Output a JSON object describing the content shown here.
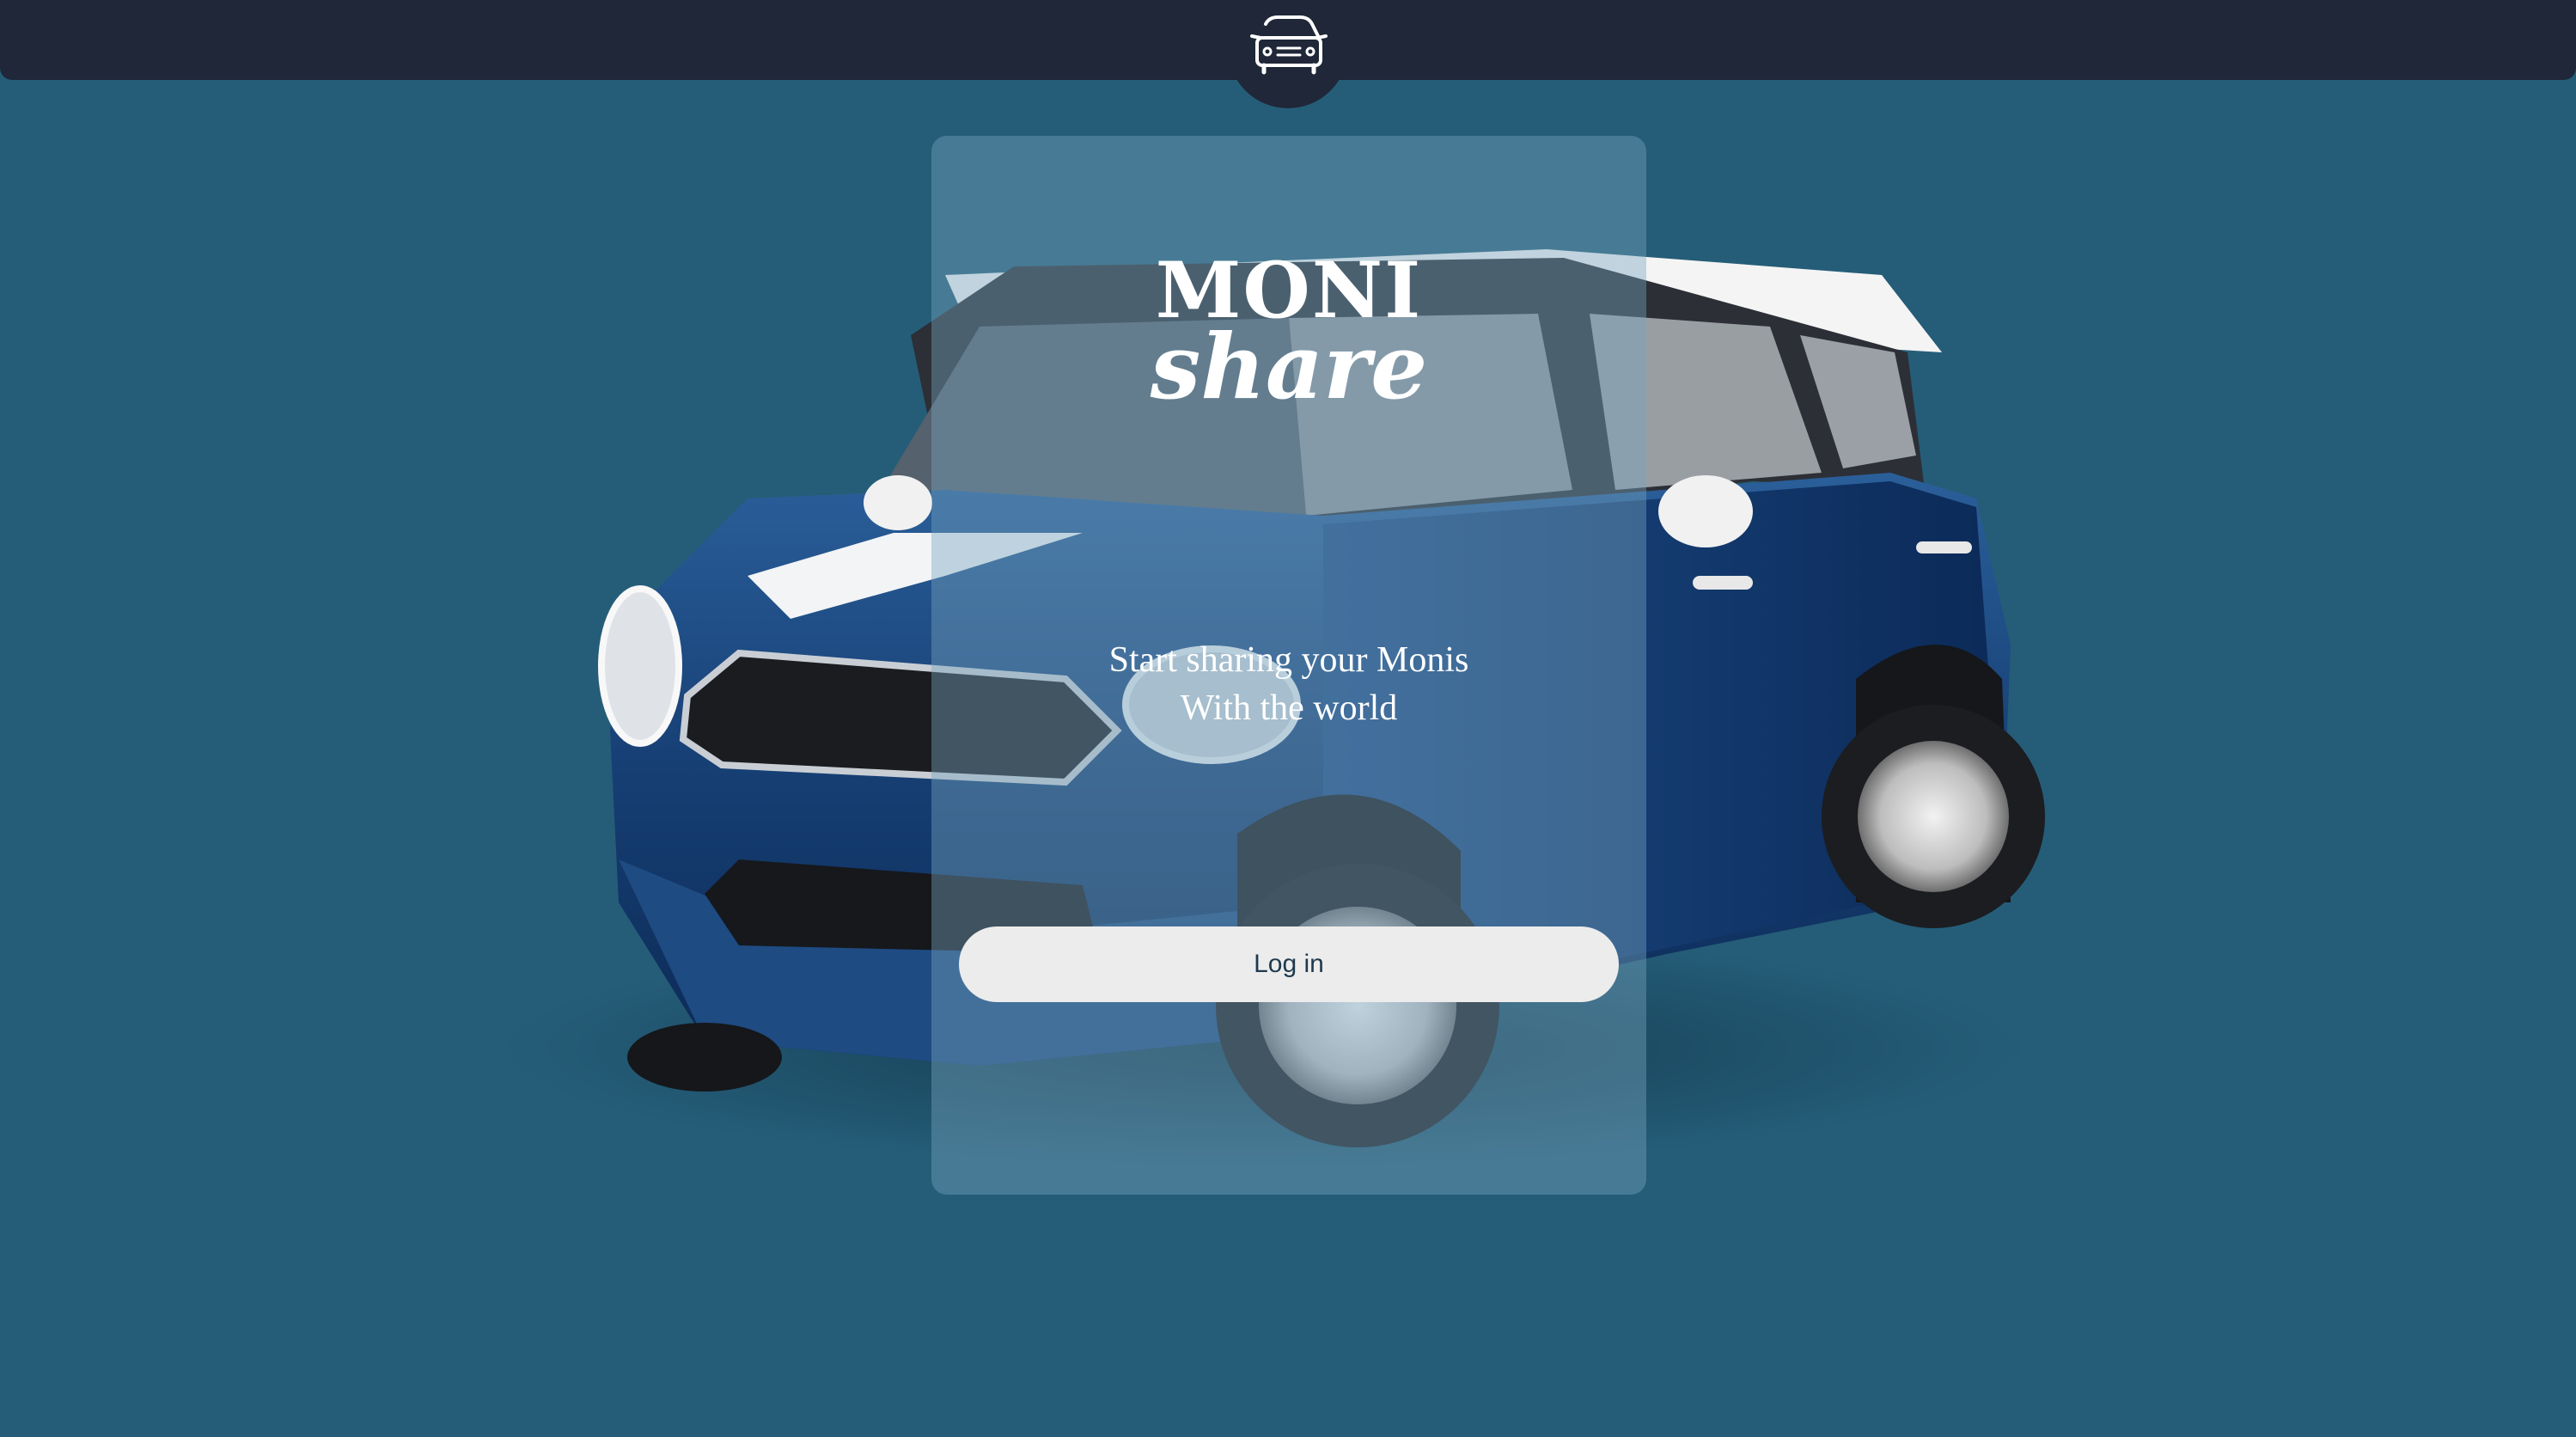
{
  "header": {
    "logo_icon": "car-icon",
    "background_color": "#1f2738"
  },
  "brand": {
    "line1": "MONI",
    "line2": "share"
  },
  "hero": {
    "tagline_line1": "Start sharing your Monis",
    "tagline_line2": "With the world",
    "background_color": "#255d78",
    "image": "blue-mini-countryman-car"
  },
  "actions": {
    "login_label": "Log in"
  }
}
